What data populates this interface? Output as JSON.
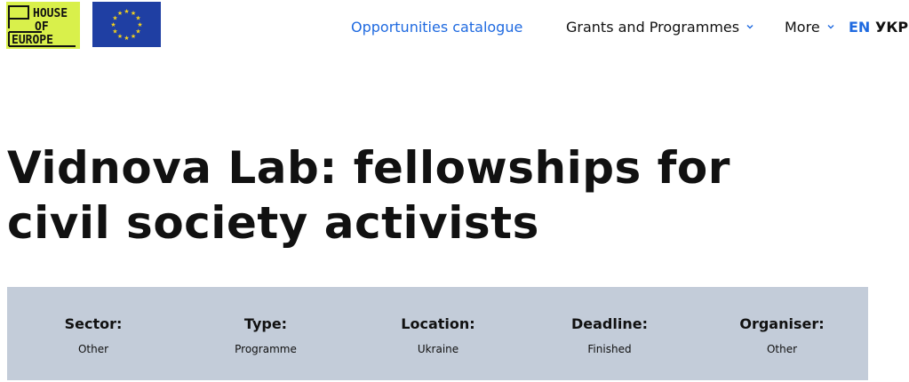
{
  "header": {
    "logo_main_alt": "HOUSE OF EUROPE",
    "logo_eu_alt": "EU",
    "nav": [
      {
        "label": "Opportunities catalogue"
      },
      {
        "label": "Grants and Programmes"
      },
      {
        "label": "More"
      }
    ],
    "langs": [
      {
        "label": "EN"
      },
      {
        "label": "УКР"
      }
    ]
  },
  "page": {
    "title": "Vidnova Lab: fellowships for civil society activists"
  },
  "info": {
    "items": [
      {
        "label": "Sector:",
        "value": "Other"
      },
      {
        "label": "Type:",
        "value": "Programme"
      },
      {
        "label": "Location:",
        "value": "Ukraine"
      },
      {
        "label": "Deadline:",
        "value": "Finished"
      },
      {
        "label": "Organiser:",
        "value": "Other"
      }
    ]
  },
  "colors": {
    "accent": "#1f6ae0",
    "logo_bg": "#d9f04b",
    "eu_blue": "#1f3fa3",
    "eu_star": "#f4d21a",
    "info_bg": "#c3ccd9"
  }
}
